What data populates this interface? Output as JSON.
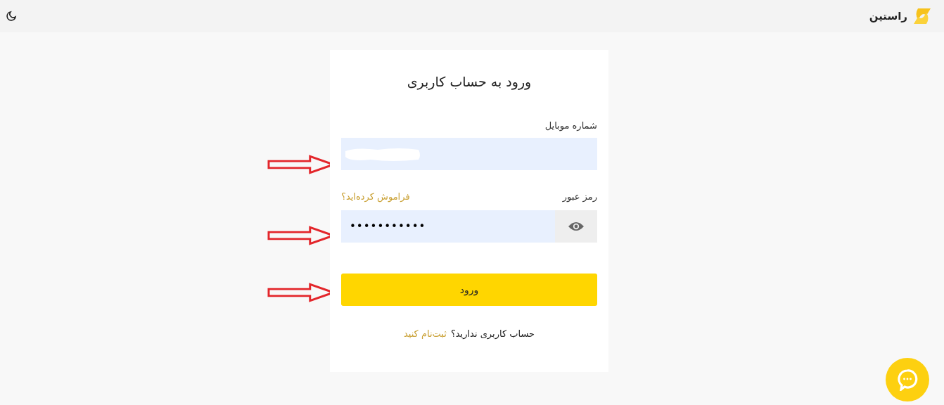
{
  "header": {
    "brand": "راستین"
  },
  "login": {
    "title": "ورود به حساب کاربری",
    "mobile": {
      "label": "شماره موبایل",
      "redacted": true
    },
    "password": {
      "label": "رمز عبور",
      "forgot_link": "فراموش کرده‌اید؟",
      "value": "•••••••••••"
    },
    "submit": "ورود",
    "signup_prompt": "حساب کاربری ندارید؟",
    "signup_link": "ثبت‌نام کنید"
  }
}
